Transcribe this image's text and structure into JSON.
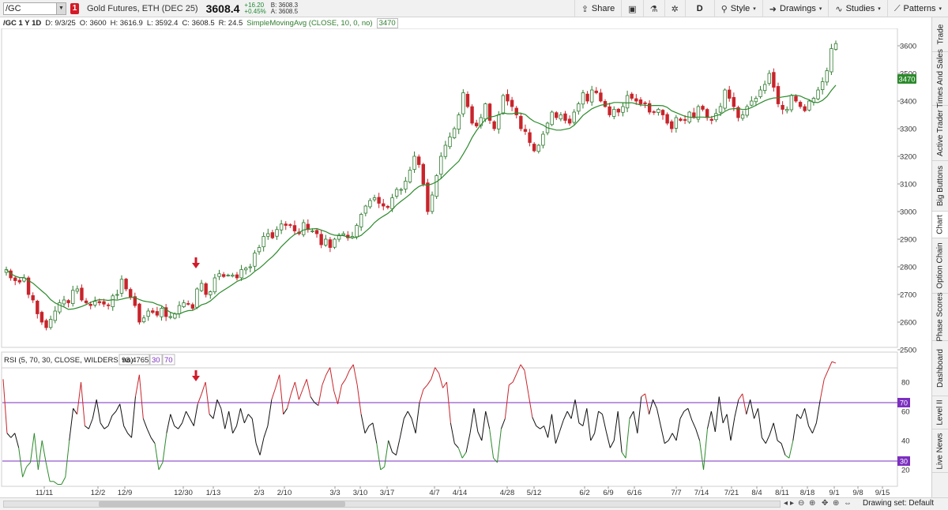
{
  "toolbar": {
    "symbol": "/GC",
    "account_badge": "1",
    "description": "Gold Futures, ETH (DEC 25)",
    "last_price": "3608.4",
    "net_change": "+16.20",
    "pct_change": "+0.45%",
    "bid": "B: 3608.3",
    "ask": "A: 3608.5",
    "share_label": "Share",
    "period_label": "D",
    "style_label": "Style",
    "drawings_label": "Drawings",
    "studies_label": "Studies",
    "patterns_label": "Patterns"
  },
  "header": {
    "chart_title": "/GC 1 Y 1D",
    "date": "D: 9/3/25",
    "open": "O: 3600",
    "high": "H: 3616.9",
    "low": "L: 3592.4",
    "close": "C: 3608.5",
    "range": "R: 24.5",
    "study_label": "SimpleMovingAvg (CLOSE, 10, 0, no)",
    "study_value": "3470"
  },
  "rsi_header": {
    "label": "RSI (5, 70, 30, CLOSE, WILDERS, no)",
    "value": "93.4765",
    "oversold": "30",
    "overbought": "70"
  },
  "price_axis": {
    "ticks": [
      "3600",
      "3500",
      "3400",
      "3300",
      "3200",
      "3100",
      "3000",
      "2900",
      "2800",
      "2700",
      "2600",
      "2500"
    ],
    "sma_tag": "3470"
  },
  "rsi_axis": {
    "ticks": [
      "80",
      "60",
      "40",
      "20"
    ],
    "tag_70": "70",
    "tag_30": "30"
  },
  "x_axis": {
    "labels": [
      "11/11",
      "12/2",
      "12/9",
      "12/30",
      "1/13",
      "2/3",
      "2/10",
      "3/3",
      "3/10",
      "3/17",
      "4/7",
      "4/14",
      "4/28",
      "5/12",
      "6/2",
      "6/9",
      "6/16",
      "7/7",
      "7/14",
      "7/21",
      "8/4",
      "8/11",
      "8/18",
      "9/1",
      "9/8",
      "9/15"
    ]
  },
  "sidebar": {
    "tabs": [
      "Trade",
      "Times And Sales",
      "Active Trader",
      "Big Buttons",
      "Chart",
      "Option Chain",
      "Phase Scores",
      "Dashboard",
      "Level II",
      "Live News"
    ],
    "active": "Chart"
  },
  "bottom_bar": {
    "drawing_set": "Drawing set: Default"
  },
  "colors": {
    "up": "#2f7a2f",
    "down": "#c8242b",
    "sma": "#2b8a2b",
    "rsi_line": "#111111",
    "rsi_overbought": "#c8242b",
    "rsi_oversold": "#2b8a2b",
    "threshold_line": "#7b2fbf",
    "arrow": "#d11a2a"
  },
  "chart_data": {
    "type": "candlestick",
    "price_range": [
      2500,
      3650
    ],
    "sma_period": 10,
    "closes": [
      2790,
      2760,
      2750,
      2745,
      2760,
      2700,
      2680,
      2630,
      2600,
      2580,
      2610,
      2640,
      2670,
      2680,
      2670,
      2715,
      2720,
      2680,
      2670,
      2660,
      2675,
      2670,
      2665,
      2660,
      2695,
      2700,
      2755,
      2720,
      2690,
      2660,
      2600,
      2615,
      2640,
      2635,
      2625,
      2650,
      2620,
      2620,
      2630,
      2660,
      2670,
      2665,
      2650,
      2720,
      2740,
      2700,
      2710,
      2760,
      2775,
      2765,
      2770,
      2770,
      2760,
      2790,
      2795,
      2800,
      2850,
      2870,
      2910,
      2920,
      2905,
      2935,
      2955,
      2950,
      2950,
      2930,
      2920,
      2960,
      2935,
      2930,
      2920,
      2880,
      2900,
      2870,
      2900,
      2915,
      2920,
      2905,
      2910,
      2950,
      2990,
      3020,
      3040,
      3050,
      3030,
      3020,
      3015,
      3050,
      3080,
      3080,
      3110,
      3150,
      3200,
      3170,
      3100,
      3000,
      3060,
      3130,
      3200,
      3240,
      3270,
      3300,
      3350,
      3430,
      3380,
      3320,
      3310,
      3340,
      3390,
      3330,
      3300,
      3350,
      3420,
      3400,
      3380,
      3350,
      3300,
      3290,
      3250,
      3220,
      3240,
      3280,
      3320,
      3360,
      3340,
      3350,
      3330,
      3320,
      3360,
      3390,
      3430,
      3400,
      3440,
      3430,
      3400,
      3380,
      3350,
      3370,
      3360,
      3380,
      3420,
      3410,
      3400,
      3390,
      3390,
      3360,
      3360,
      3370,
      3350,
      3320,
      3300,
      3340,
      3330,
      3330,
      3360,
      3340,
      3380,
      3370,
      3340,
      3330,
      3355,
      3380,
      3440,
      3410,
      3380,
      3340,
      3350,
      3380,
      3400,
      3410,
      3440,
      3460,
      3500,
      3450,
      3390,
      3370,
      3370,
      3420,
      3400,
      3380,
      3365,
      3400,
      3410,
      3440,
      3470,
      3510,
      3590,
      3608
    ],
    "rsi": {
      "range": [
        10,
        100
      ],
      "overbought": 70,
      "oversold": 30,
      "values": [
        82,
        45,
        42,
        45,
        35,
        15,
        22,
        25,
        45,
        20,
        40,
        25,
        12,
        12,
        10,
        10,
        15,
        40,
        62,
        58,
        80,
        50,
        48,
        55,
        68,
        52,
        48,
        50,
        57,
        60,
        65,
        50,
        45,
        42,
        70,
        85,
        55,
        48,
        42,
        38,
        20,
        25,
        45,
        58,
        50,
        48,
        52,
        60,
        55,
        50,
        65,
        72,
        80,
        58,
        55,
        68,
        62,
        48,
        60,
        45,
        50,
        62,
        52,
        58,
        55,
        38,
        30,
        42,
        50,
        68,
        76,
        85,
        58,
        62,
        72,
        80,
        68,
        75,
        82,
        70,
        66,
        64,
        78,
        85,
        90,
        74,
        65,
        78,
        82,
        88,
        92,
        78,
        58,
        45,
        50,
        52,
        38,
        20,
        22,
        40,
        32,
        30,
        42,
        55,
        60,
        55,
        45,
        66,
        75,
        78,
        82,
        90,
        86,
        76,
        80,
        52,
        38,
        35,
        28,
        32,
        45,
        62,
        46,
        40,
        60,
        48,
        28,
        25,
        48,
        55,
        78,
        80,
        86,
        92,
        88,
        72,
        56,
        50,
        48,
        50,
        42,
        58,
        38,
        46,
        54,
        60,
        55,
        68,
        52,
        50,
        62,
        40,
        45,
        60,
        58,
        46,
        35,
        40,
        60,
        32,
        28,
        55,
        60,
        45,
        70,
        72,
        58,
        68,
        62,
        50,
        38,
        40,
        45,
        40,
        55,
        60,
        62,
        54,
        48,
        40,
        20,
        48,
        60,
        46,
        70,
        52,
        58,
        40,
        56,
        68,
        72,
        58,
        68,
        55,
        62,
        42,
        38,
        44,
        52,
        40,
        38,
        30,
        28,
        40,
        58,
        55,
        62,
        50,
        45,
        52,
        68,
        82,
        88,
        94,
        93
      ]
    }
  }
}
